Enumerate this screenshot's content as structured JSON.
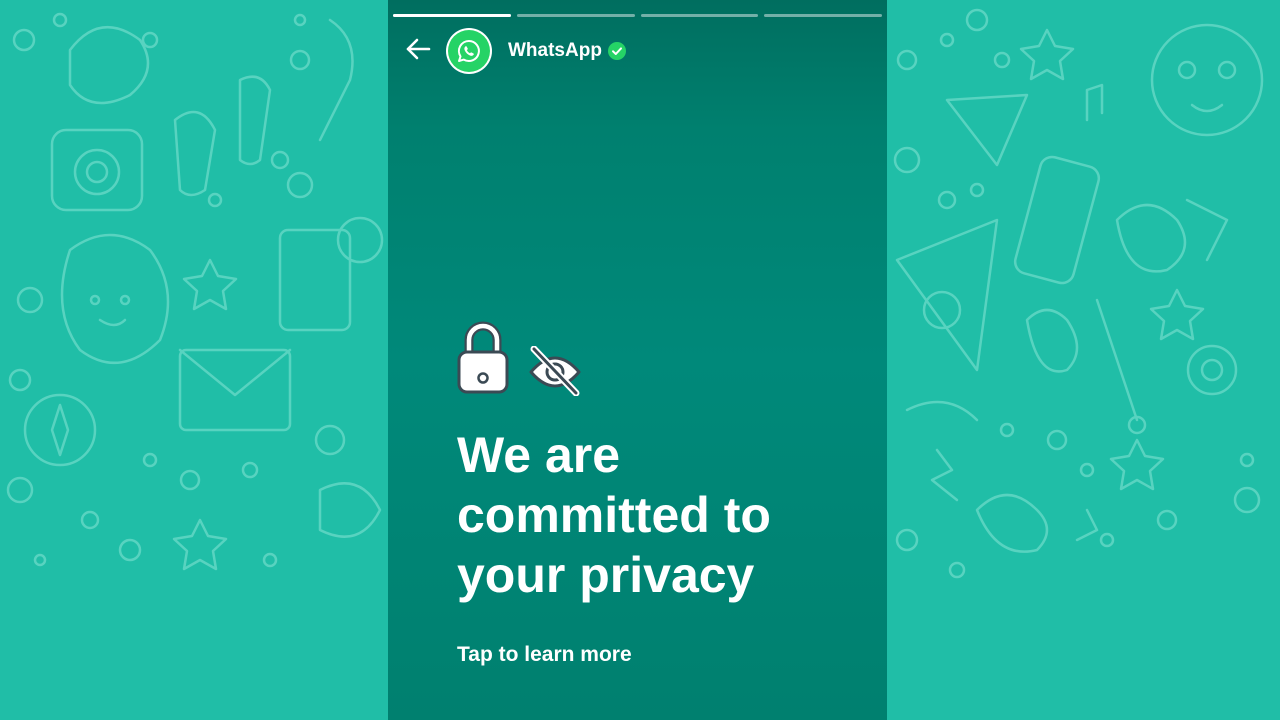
{
  "story": {
    "account_name": "WhatsApp",
    "verified": true,
    "headline": "We are committed to your privacy",
    "cta_label": "Tap to learn more",
    "progress": [
      1.0,
      0.0,
      0.0,
      0.0
    ]
  },
  "icons": {
    "back": "arrow-left-icon",
    "avatar": "whatsapp-logo-icon",
    "verified": "verified-check-icon",
    "lock": "padlock-icon",
    "hidden": "eye-slash-icon"
  },
  "colors": {
    "background": "#20bea7",
    "story_bg": "#00897a",
    "brand_green": "#25d366",
    "text": "#ffffff"
  }
}
